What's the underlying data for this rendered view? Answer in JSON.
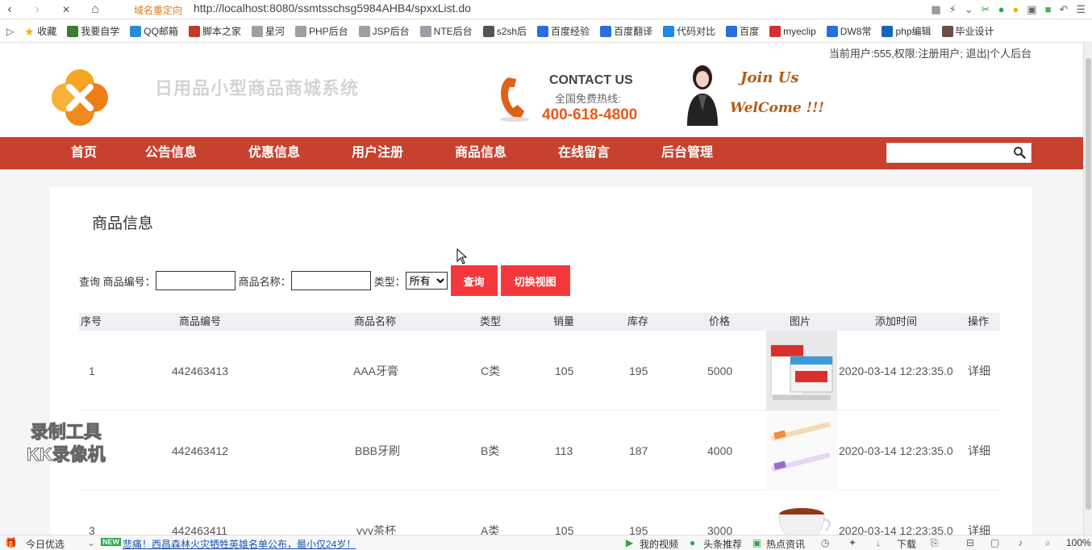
{
  "browser": {
    "redirect_label": "域名重定向",
    "url": "http://localhost:8080/ssmtsschsg5984AHB4/spxxList.do",
    "bookmarks": [
      {
        "label": "收藏",
        "color": "#f2b400"
      },
      {
        "label": "我要自学",
        "color": "#3a7d2b"
      },
      {
        "label": "QQ邮箱",
        "color": "#2c8bd8"
      },
      {
        "label": "脚本之家",
        "color": "#c0392b"
      },
      {
        "label": "星河",
        "color": "#9aa0a6"
      },
      {
        "label": "PHP后台",
        "color": "#9aa0a6"
      },
      {
        "label": "JSP后台",
        "color": "#9aa0a6"
      },
      {
        "label": "NTE后台",
        "color": "#9aa0a6"
      },
      {
        "label": "s2sh后",
        "color": "#555555"
      },
      {
        "label": "百度经验",
        "color": "#2d6cdf"
      },
      {
        "label": "百度翻译",
        "color": "#2d6cdf"
      },
      {
        "label": "代码对比",
        "color": "#1e88e5"
      },
      {
        "label": "百度",
        "color": "#2d6cdf"
      },
      {
        "label": "myeclip",
        "color": "#d32f2f"
      },
      {
        "label": "DW8常",
        "color": "#2d6cdf"
      },
      {
        "label": "php编辑",
        "color": "#1565c0"
      },
      {
        "label": "毕业设计",
        "color": "#6d4c41"
      }
    ]
  },
  "header": {
    "user_info": "当前用户:555,权限:注册用户; 退出|个人后台",
    "site_title": "日用品小型商品商城系统",
    "contact_title": "CONTACT US",
    "contact_sub": "全国免费热线:",
    "contact_phone": "400-618-4800",
    "join_us": "Join Us",
    "welcome": "WelCome !!!"
  },
  "nav": {
    "items": [
      {
        "label": "首页"
      },
      {
        "label": "公告信息"
      },
      {
        "label": "优惠信息"
      },
      {
        "label": "用户注册"
      },
      {
        "label": "商品信息"
      },
      {
        "label": "在线留言"
      },
      {
        "label": "后台管理"
      }
    ]
  },
  "main": {
    "section_title": "商品信息",
    "filter": {
      "query_label": "查询 商品编号：",
      "code_value": "",
      "name_label": "商品名称：",
      "name_value": "",
      "type_label": "类型：",
      "type_selected": "所有",
      "search_button": "查询",
      "toggle_button": "切换视图"
    },
    "table": {
      "headers": [
        "序号",
        "商品编号",
        "商品名称",
        "类型",
        "销量",
        "库存",
        "价格",
        "图片",
        "添加时间",
        "操作"
      ],
      "rows": [
        {
          "index": "1",
          "code": "442463413",
          "name": "AAA牙膏",
          "type": "C类",
          "sales": "105",
          "stock": "195",
          "price": "5000",
          "image": "toothpaste",
          "time": "2020-03-14 12:23:35.0",
          "action": "详细"
        },
        {
          "index": "",
          "code": "442463412",
          "name": "BBB牙刷",
          "type": "B类",
          "sales": "113",
          "stock": "187",
          "price": "4000",
          "image": "toothbrush",
          "time": "2020-03-14 12:23:35.0",
          "action": "详细"
        },
        {
          "index": "3",
          "code": "442463411",
          "name": "yyy茶杯",
          "type": "A类",
          "sales": "105",
          "stock": "195",
          "price": "3000",
          "image": "teacup",
          "time": "2020-03-14 12:23:35.0",
          "action": "详细"
        }
      ]
    }
  },
  "watermark": {
    "line1": "录制工具",
    "line2": "KK录像机"
  },
  "statusbar": {
    "today": "今日优选",
    "new_badge": "NEW",
    "news": "悲痛！西昌森林火灾牺牲英雄名单公布，最小仅24岁！",
    "my_video": "我的视频",
    "headline": "头条推荐",
    "hot_news": "热点资讯",
    "download": "下载",
    "zoom": "100%"
  }
}
